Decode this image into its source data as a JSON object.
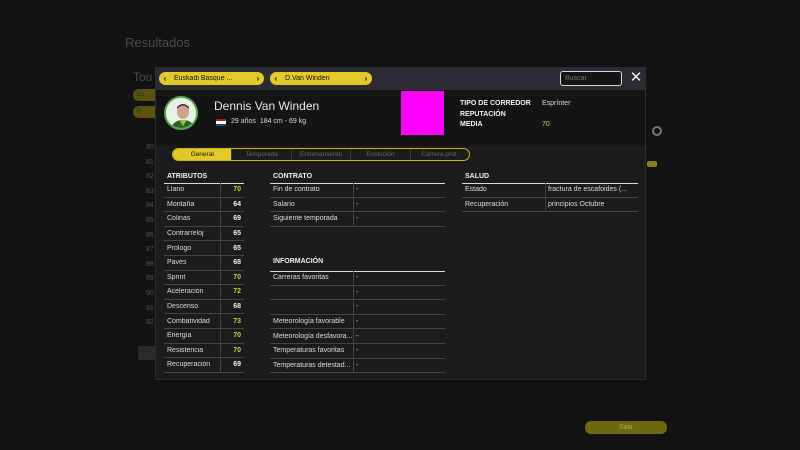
{
  "background": {
    "title": "Resultados",
    "tour_label": "Tou",
    "pills": [
      "Eu",
      "E"
    ],
    "row_numbers": [
      "80",
      "81",
      "82",
      "83",
      "84",
      "85",
      "86",
      "87",
      "88",
      "89",
      "90",
      "91",
      "92"
    ],
    "exit_label": "Salir"
  },
  "modal": {
    "team_selector": "Euskadi Basque ...",
    "rider_selector": "D.Van Winden",
    "search_placeholder": "Buscar"
  },
  "rider": {
    "name": "Dennis Van Winden",
    "age": "29 años",
    "height_weight": "184 cm - 69 kg",
    "flag_colors": [
      "#ae1c28",
      "#ffffff",
      "#21468b"
    ]
  },
  "summary": {
    "labels": [
      "TIPO DE CORREDOR",
      "REPUTACIÓN",
      "MEDIA"
    ],
    "type_value": "Esprínter",
    "reputation_value": "",
    "average_value": "70"
  },
  "tabs": [
    "General",
    "Temporada",
    "Entrenamiento",
    "Evolución",
    "Carrera prof."
  ],
  "attributes": {
    "title": "ATRIBUTOS",
    "rows": [
      {
        "name": "Llano",
        "value": "70",
        "highlight": true
      },
      {
        "name": "Montaña",
        "value": "64",
        "highlight": false
      },
      {
        "name": "Colinas",
        "value": "69",
        "highlight": false
      },
      {
        "name": "Contrarreloj",
        "value": "65",
        "highlight": false
      },
      {
        "name": "Prólogo",
        "value": "65",
        "highlight": false
      },
      {
        "name": "Pavés",
        "value": "68",
        "highlight": false
      },
      {
        "name": "Sprint",
        "value": "70",
        "highlight": true
      },
      {
        "name": "Aceleración",
        "value": "72",
        "highlight": true
      },
      {
        "name": "Descenso",
        "value": "68",
        "highlight": false
      },
      {
        "name": "Combatividad",
        "value": "73",
        "highlight": true
      },
      {
        "name": "Energía",
        "value": "70",
        "highlight": true
      },
      {
        "name": "Resistencia",
        "value": "70",
        "highlight": true
      },
      {
        "name": "Recuperación",
        "value": "69",
        "highlight": false
      }
    ]
  },
  "contract": {
    "title": "CONTRATO",
    "rows": [
      {
        "name": "Fin de contrato",
        "value": "-"
      },
      {
        "name": "Salario",
        "value": "-"
      },
      {
        "name": "Siguiente temporada",
        "value": "-"
      }
    ]
  },
  "information": {
    "title": "INFORMACIÓN",
    "rows": [
      {
        "name": "Carreras favoritas",
        "value": "-"
      },
      {
        "name": "",
        "value": "-"
      },
      {
        "name": "",
        "value": "-"
      },
      {
        "name": "Meteorología favorable",
        "value": "-"
      },
      {
        "name": "Meteorología desfavora...",
        "value": "-"
      },
      {
        "name": "Temperaturas favoritas",
        "value": "-"
      },
      {
        "name": "Temperaturas detestad...",
        "value": "-"
      }
    ]
  },
  "health": {
    "title": "SALUD",
    "rows": [
      {
        "name": "Estado",
        "value": "fractura de escafoides (..."
      },
      {
        "name": "Recuperación",
        "value": "principios Octubre"
      }
    ]
  }
}
